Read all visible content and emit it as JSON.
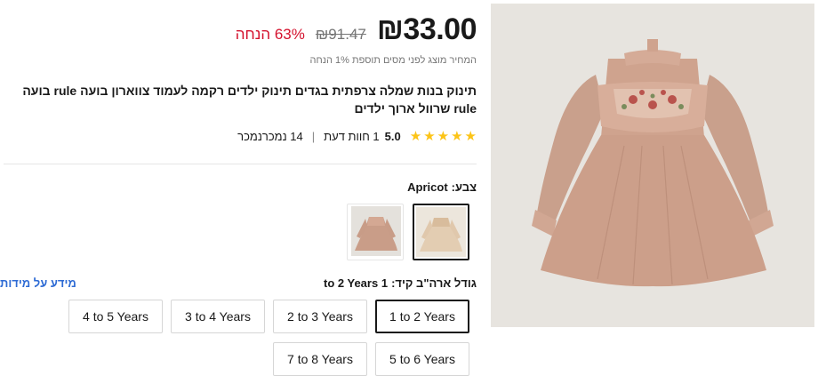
{
  "product": {
    "price_current": "₪33.00",
    "price_original": "₪91.47",
    "discount": "63% הנחה",
    "tax_note": "המחיר מוצג לפני מסים תוספת 1% הנחה",
    "title": "תינוק בנות שמלה צרפתית בגדים תינוק ילדים רקמה לעמוד צווארון בועה rule בועה rule שרוול ארוך ילדים",
    "rating": "5.0",
    "reviews": "1 חוות דעת",
    "sold": "14 נמכרנמכר",
    "star_color": "#fcc417",
    "discount_color": "#d4112d"
  },
  "color": {
    "label": "צבע:",
    "selected_value": "Apricot",
    "swatches": [
      {
        "name": "Apricot",
        "selected": true
      },
      {
        "name": "Pink",
        "selected": false
      }
    ]
  },
  "size": {
    "label": "גודל ארה\"ב קיד:",
    "selected_value": "1 to 2 Years",
    "guide_link": "מידע על מידות",
    "options": [
      "1 to 2 Years",
      "2 to 3 Years",
      "3 to 4 Years",
      "4 to 5 Years",
      "5 to 6 Years",
      "7 to 8 Years"
    ],
    "selected_index": 0,
    "link_color": "#2e6bd4"
  }
}
